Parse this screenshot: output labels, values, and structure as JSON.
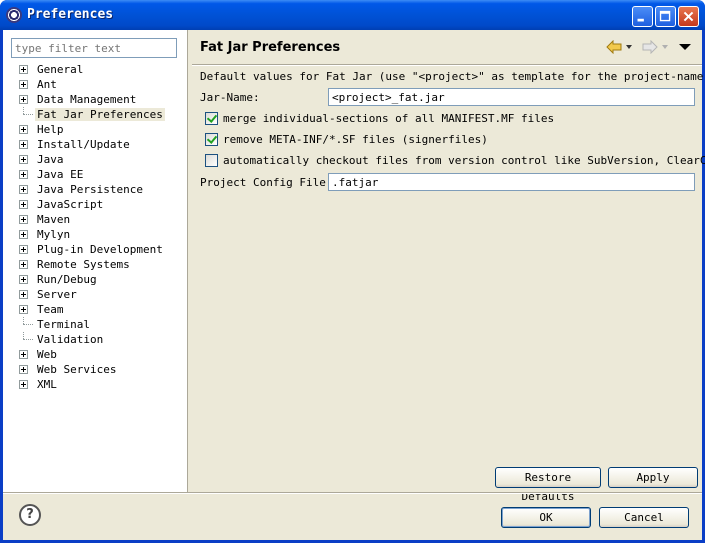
{
  "window": {
    "title": "Preferences"
  },
  "filter": {
    "placeholder": "type filter text"
  },
  "tree": [
    {
      "label": "General",
      "expandable": true
    },
    {
      "label": "Ant",
      "expandable": true
    },
    {
      "label": "Data Management",
      "expandable": true
    },
    {
      "label": "Fat Jar Preferences",
      "expandable": false,
      "selected": true
    },
    {
      "label": "Help",
      "expandable": true
    },
    {
      "label": "Install/Update",
      "expandable": true
    },
    {
      "label": "Java",
      "expandable": true
    },
    {
      "label": "Java EE",
      "expandable": true
    },
    {
      "label": "Java Persistence",
      "expandable": true
    },
    {
      "label": "JavaScript",
      "expandable": true
    },
    {
      "label": "Maven",
      "expandable": true
    },
    {
      "label": "Mylyn",
      "expandable": true
    },
    {
      "label": "Plug-in Development",
      "expandable": true
    },
    {
      "label": "Remote Systems",
      "expandable": true
    },
    {
      "label": "Run/Debug",
      "expandable": true
    },
    {
      "label": "Server",
      "expandable": true
    },
    {
      "label": "Team",
      "expandable": true
    },
    {
      "label": "Terminal",
      "expandable": false
    },
    {
      "label": "Validation",
      "expandable": false
    },
    {
      "label": "Web",
      "expandable": true
    },
    {
      "label": "Web Services",
      "expandable": true
    },
    {
      "label": "XML",
      "expandable": true
    }
  ],
  "page": {
    "title": "Fat Jar Preferences",
    "description": "Default values for Fat Jar (use \"<project>\" as template for the project-name)",
    "jar_name_label": "Jar-Name:",
    "jar_name_value": "<project>_fat.jar",
    "options": [
      {
        "label": "merge individual-sections of all MANIFEST.MF files",
        "checked": true
      },
      {
        "label": "remove META-INF/*.SF files (signerfiles)",
        "checked": true
      },
      {
        "label": "automatically checkout files from version control like SubVersion, ClearCase...",
        "checked": false
      }
    ],
    "config_label": "Project Config File:",
    "config_value": ".fatjar",
    "restore_defaults": "Restore Defaults",
    "apply": "Apply"
  },
  "footer": {
    "ok": "OK",
    "cancel": "Cancel",
    "help": "?"
  }
}
